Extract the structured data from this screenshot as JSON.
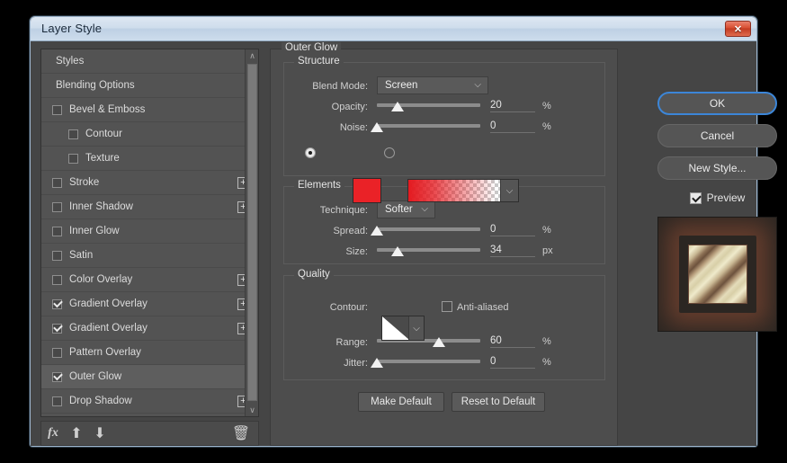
{
  "window": {
    "title": "Layer Style",
    "close_label": "✕"
  },
  "styles_list": {
    "items": [
      {
        "label": "Styles",
        "checkbox": null,
        "indent": "header",
        "plus": false,
        "selected": false
      },
      {
        "label": "Blending Options",
        "checkbox": null,
        "indent": "header",
        "plus": false,
        "selected": false
      },
      {
        "label": "Bevel & Emboss",
        "checkbox": false,
        "indent": "top",
        "plus": false,
        "selected": false
      },
      {
        "label": "Contour",
        "checkbox": false,
        "indent": "sub",
        "plus": false,
        "selected": false
      },
      {
        "label": "Texture",
        "checkbox": false,
        "indent": "sub",
        "plus": false,
        "selected": false
      },
      {
        "label": "Stroke",
        "checkbox": false,
        "indent": "top",
        "plus": true,
        "selected": false
      },
      {
        "label": "Inner Shadow",
        "checkbox": false,
        "indent": "top",
        "plus": true,
        "selected": false
      },
      {
        "label": "Inner Glow",
        "checkbox": false,
        "indent": "top",
        "plus": false,
        "selected": false
      },
      {
        "label": "Satin",
        "checkbox": false,
        "indent": "top",
        "plus": false,
        "selected": false
      },
      {
        "label": "Color Overlay",
        "checkbox": false,
        "indent": "top",
        "plus": true,
        "selected": false
      },
      {
        "label": "Gradient Overlay",
        "checkbox": true,
        "indent": "top",
        "plus": true,
        "selected": false
      },
      {
        "label": "Gradient Overlay",
        "checkbox": true,
        "indent": "top",
        "plus": true,
        "selected": false
      },
      {
        "label": "Pattern Overlay",
        "checkbox": false,
        "indent": "top",
        "plus": false,
        "selected": false
      },
      {
        "label": "Outer Glow",
        "checkbox": true,
        "indent": "top",
        "plus": false,
        "selected": true
      },
      {
        "label": "Drop Shadow",
        "checkbox": false,
        "indent": "top",
        "plus": true,
        "selected": false
      }
    ],
    "scroll_up": "∧",
    "scroll_down": "∨"
  },
  "fx_toolbar": {
    "fx_label": "fx",
    "move_up": "⬆",
    "move_down": "⬇",
    "delete": "🗑"
  },
  "effect_panel": {
    "title": "Outer Glow",
    "structure": {
      "title": "Structure",
      "blend_mode_label": "Blend Mode:",
      "blend_mode_value": "Screen",
      "opacity_label": "Opacity:",
      "opacity_value": "20",
      "opacity_unit": "%",
      "noise_label": "Noise:",
      "noise_value": "0",
      "noise_unit": "%",
      "fill_type": "color",
      "color_hex": "#ea2227"
    },
    "elements": {
      "title": "Elements",
      "technique_label": "Technique:",
      "technique_value": "Softer",
      "spread_label": "Spread:",
      "spread_value": "0",
      "spread_unit": "%",
      "size_label": "Size:",
      "size_value": "34",
      "size_unit": "px"
    },
    "quality": {
      "title": "Quality",
      "contour_label": "Contour:",
      "antialiased_label": "Anti-aliased",
      "antialiased_checked": false,
      "range_label": "Range:",
      "range_value": "60",
      "range_unit": "%",
      "jitter_label": "Jitter:",
      "jitter_value": "0",
      "jitter_unit": "%"
    },
    "make_default": "Make Default",
    "reset_to_default": "Reset to Default"
  },
  "actions": {
    "ok": "OK",
    "cancel": "Cancel",
    "new_style": "New Style...",
    "preview": "Preview",
    "preview_checked": true
  },
  "sliders": {
    "opacity_pct": 20,
    "noise_pct": 0,
    "spread_pct": 0,
    "size_pct": 20,
    "range_pct": 60,
    "jitter_pct": 0
  }
}
